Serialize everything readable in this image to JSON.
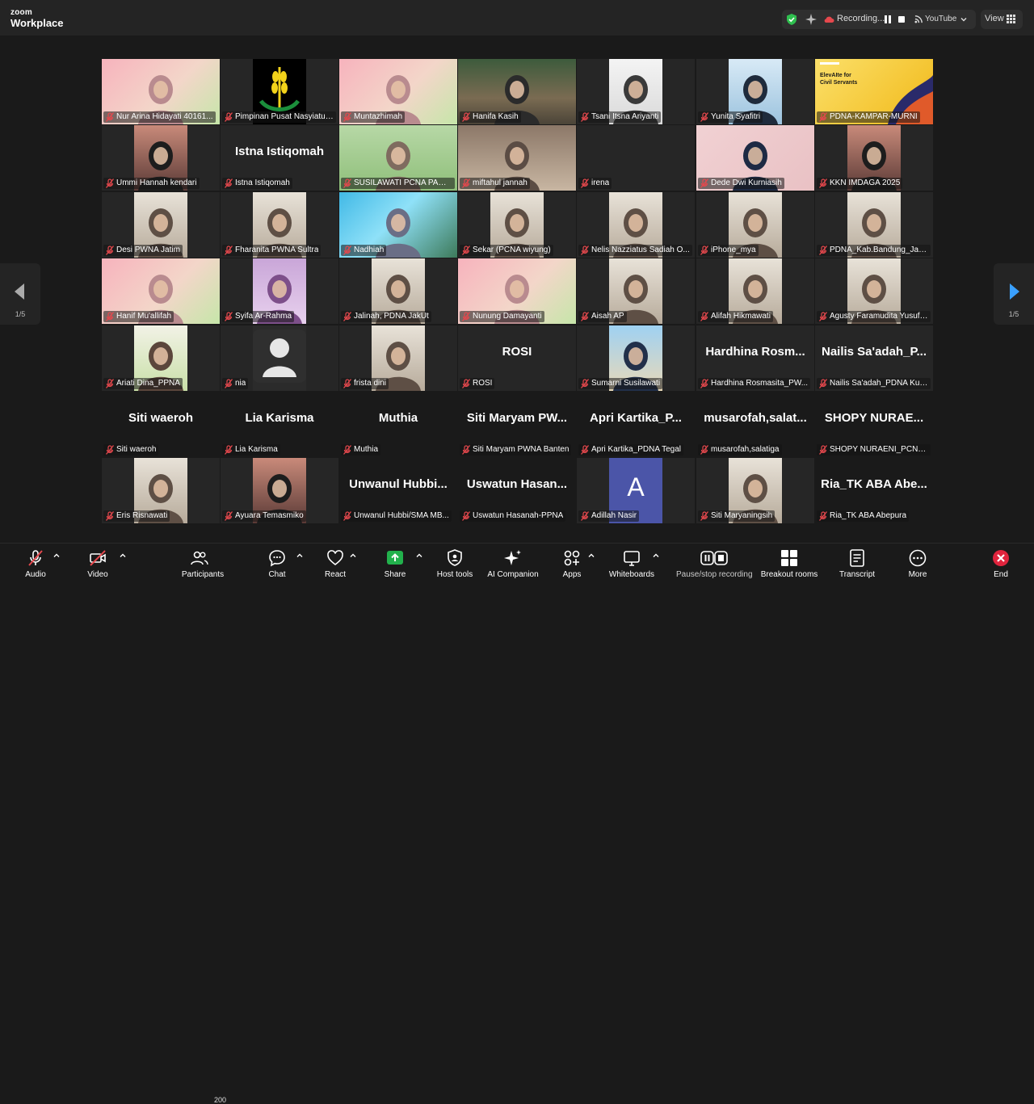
{
  "app": {
    "logo_line1": "zoom",
    "logo_line2": "Workplace"
  },
  "topbar": {
    "recording_text": "Recording...",
    "stream_text": "YouTube",
    "view_label": "View"
  },
  "pagination": {
    "left": "1/5",
    "right": "1/5"
  },
  "participants_count": "200",
  "tiles": [
    {
      "name": "Nur Arina Hidayati 40161...",
      "big": "",
      "video": "pink",
      "selected": true
    },
    {
      "name": "Pimpinan Pusat Nasyiatul...",
      "big": "",
      "video": "logo"
    },
    {
      "name": "Muntazhimah",
      "big": "",
      "video": "pink"
    },
    {
      "name": "Hanifa Kasih",
      "big": "",
      "video": "outdoor"
    },
    {
      "name": "Tsani Itsna Ariyanti",
      "big": "",
      "video": "portrait"
    },
    {
      "name": "Yunita Syafitri",
      "big": "",
      "video": "grad"
    },
    {
      "name": "PDNA-KAMPAR-MURNI",
      "big": "",
      "video": "yellow"
    },
    {
      "name": "Ummi Hannah kendari",
      "big": "",
      "video": "small-dark"
    },
    {
      "name": "Istna Istiqomah",
      "big": "Istna Istiqomah",
      "video": "none"
    },
    {
      "name": "SUSILAWATI PCNA PAMU...",
      "big": "",
      "video": "green"
    },
    {
      "name": "miftahul jannah",
      "big": "",
      "video": "brown"
    },
    {
      "name": "irena",
      "big": "",
      "video": "none"
    },
    {
      "name": "Dede Dwi Kurniasih",
      "big": "",
      "video": "pinkwall"
    },
    {
      "name": "KKN IMDAGA 2025",
      "big": "",
      "video": "small-dark"
    },
    {
      "name": "Desi PWNA Jatim",
      "big": "",
      "video": "small-light"
    },
    {
      "name": "Fharanita PWNA Sultra",
      "big": "",
      "video": "small-light"
    },
    {
      "name": "Nadhiah",
      "big": "",
      "video": "banner"
    },
    {
      "name": "Sekar (PCNA wiyung)",
      "big": "",
      "video": "small-light"
    },
    {
      "name": "Nelis Nazziatus Sadiah O...",
      "big": "",
      "video": "small-light"
    },
    {
      "name": "iPhone_mya",
      "big": "",
      "video": "small-light"
    },
    {
      "name": "PDNA_Kab.Bandung_Jaba...",
      "big": "",
      "video": "small-light"
    },
    {
      "name": "Hanif Mu'allifah",
      "big": "",
      "video": "pink"
    },
    {
      "name": "Syifa Ar-Rahma",
      "big": "",
      "video": "purple"
    },
    {
      "name": "Jalinah, PDNA JakUt",
      "big": "",
      "video": "small-light"
    },
    {
      "name": "Nunung Damayanti",
      "big": "",
      "video": "pink"
    },
    {
      "name": "Aisah AP",
      "big": "",
      "video": "small-light"
    },
    {
      "name": "Alifah Hikmawati",
      "big": "",
      "video": "small-light"
    },
    {
      "name": "Agusty Faramudita Yusuf,...",
      "big": "",
      "video": "small-light"
    },
    {
      "name": "Ariati Dina_PPNA",
      "big": "",
      "video": "green-small"
    },
    {
      "name": "nia",
      "big": "",
      "video": "avatar"
    },
    {
      "name": "frista dini",
      "big": "",
      "video": "small-light"
    },
    {
      "name": "ROSI",
      "big": "ROSI",
      "video": "none"
    },
    {
      "name": "Sumarni Susilawati",
      "big": "",
      "video": "sky"
    },
    {
      "name": "Hardhina Rosmasita_PW...",
      "big": "Hardhina Rosm...",
      "video": "none"
    },
    {
      "name": "Nailis Sa'adah_PDNA Kud...",
      "big": "Nailis Sa'adah_P...",
      "video": "none"
    },
    {
      "name": "Siti waeroh",
      "big": "Siti waeroh",
      "video": "none-black"
    },
    {
      "name": "Lia Karisma",
      "big": "Lia Karisma",
      "video": "none-black"
    },
    {
      "name": "Muthia",
      "big": "Muthia",
      "video": "none-black"
    },
    {
      "name": "Siti Maryam PWNA Banten",
      "big": "Siti Maryam PW...",
      "video": "none-black"
    },
    {
      "name": "Apri  Kartika_PDNA Tegal",
      "big": "Apri  Kartika_P...",
      "video": "none-black"
    },
    {
      "name": "musarofah,salatiga",
      "big": "musarofah,salat...",
      "video": "none-black"
    },
    {
      "name": "SHOPY NURAENI_PCNAL...",
      "big": "SHOPY NURAE...",
      "video": "none-black"
    },
    {
      "name": "Eris Risnawati",
      "big": "",
      "video": "small-light"
    },
    {
      "name": "Ayuara Temasmiko",
      "big": "",
      "video": "small-dark"
    },
    {
      "name": "Unwanul Hubbi/SMA MB...",
      "big": "Unwanul Hubbi...",
      "video": "none-black"
    },
    {
      "name": "Uswatun Hasanah-PPNA",
      "big": "Uswatun  Hasan...",
      "video": "none-black"
    },
    {
      "name": "Adillah Nasir",
      "big": "",
      "video": "letter",
      "letter": "A"
    },
    {
      "name": "Siti Maryaningsih",
      "big": "",
      "video": "small-light"
    },
    {
      "name": "Ria_TK ABA Abepura",
      "big": "Ria_TK  ABA  Abe...",
      "video": "none-black"
    }
  ],
  "toolbar": {
    "audio": "Audio",
    "video": "Video",
    "participants": "Participants",
    "chat": "Chat",
    "react": "React",
    "share": "Share",
    "host_tools": "Host tools",
    "ai_companion": "AI Companion",
    "apps": "Apps",
    "whiteboards": "Whiteboards",
    "pause_recording": "Pause/stop recording",
    "breakout_rooms": "Breakout rooms",
    "transcript": "Transcript",
    "more": "More",
    "end": "End"
  },
  "colors": {
    "accent_green": "#2fd45a",
    "share_green": "#22b14c",
    "end_red": "#e0243d",
    "muted_red": "#e5484d"
  }
}
